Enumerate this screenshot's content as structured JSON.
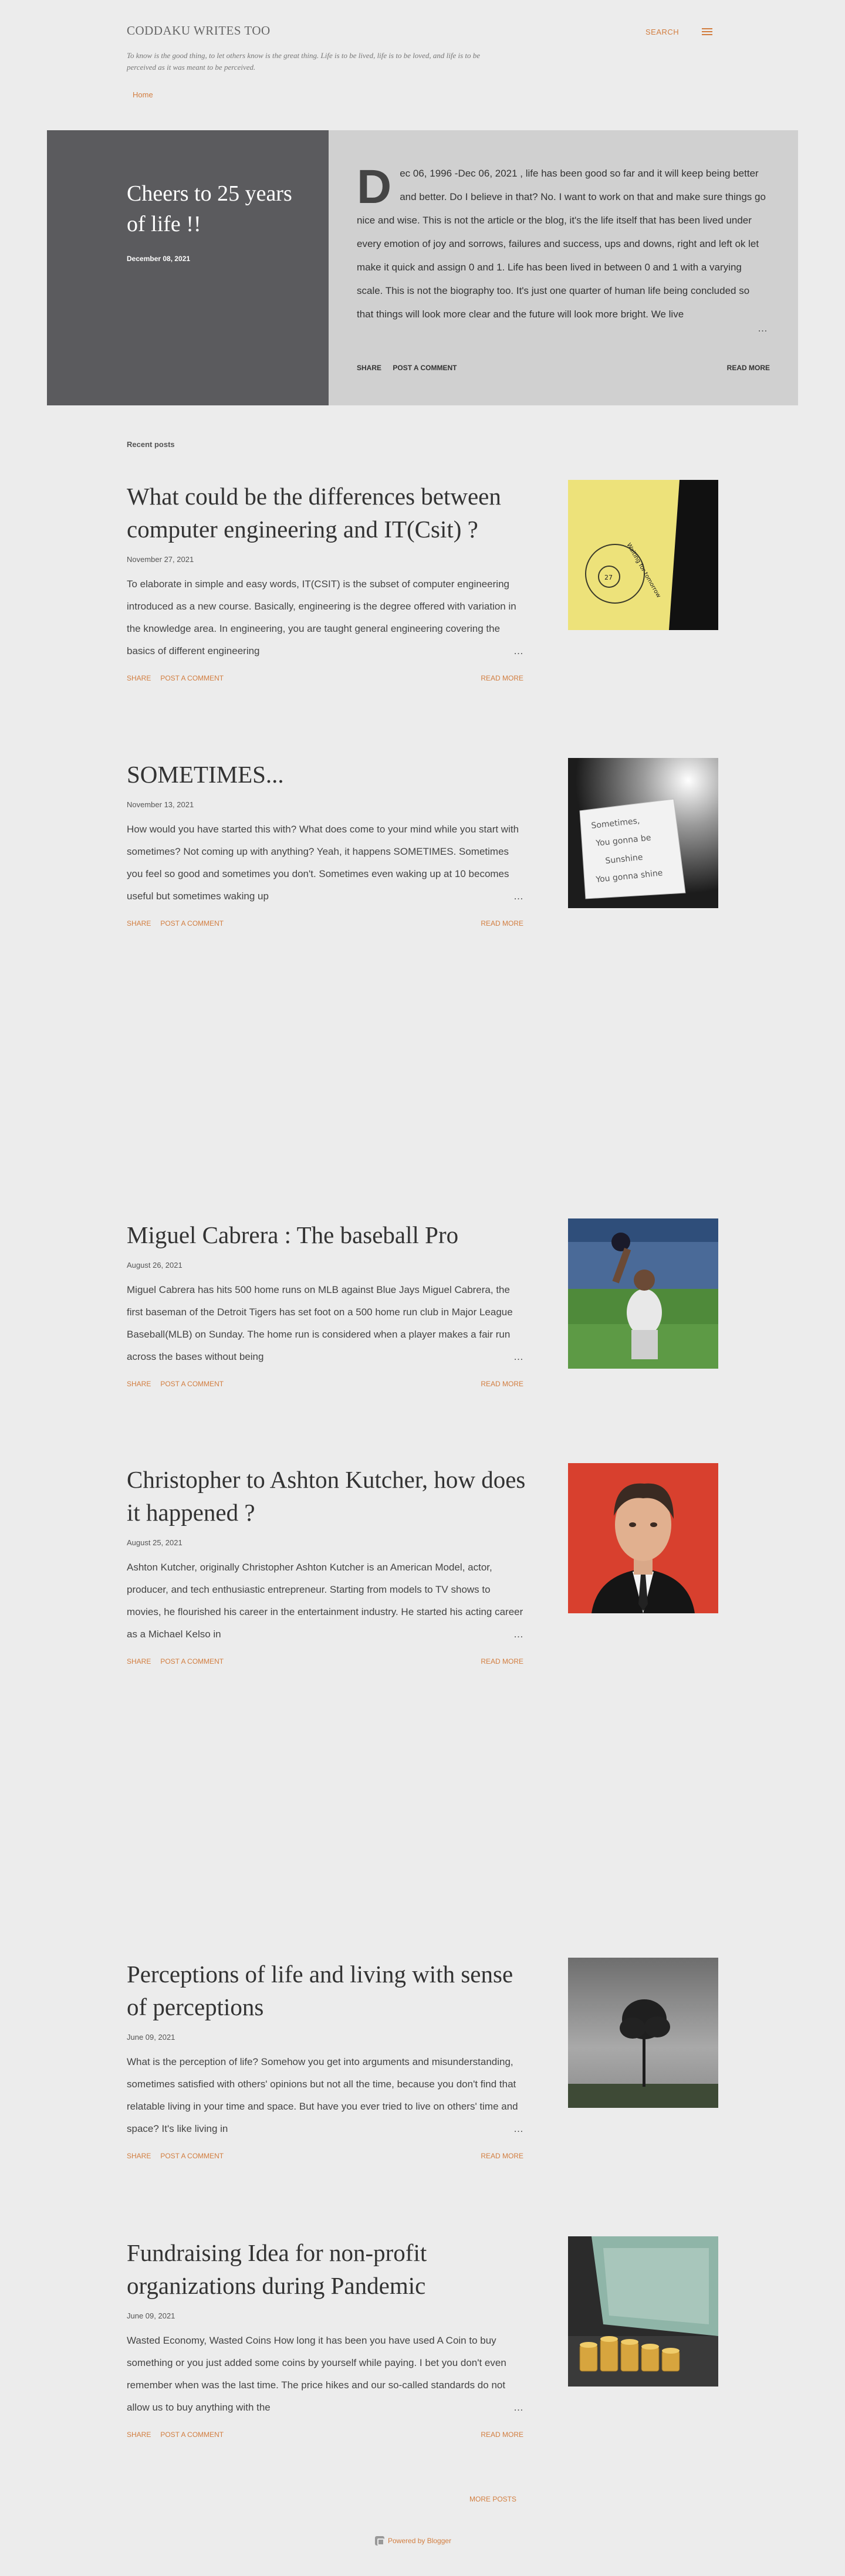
{
  "header": {
    "title": "CODDAKU WRITES TOO",
    "description": "To know is the good thing, to let others know is the great thing. Life is to be lived, life is to be loved, and life is to be perceived as it was meant to be perceived.",
    "search_label": "SEARCH"
  },
  "nav": {
    "home": "Home"
  },
  "featured": {
    "title": "Cheers to 25 years of life !!",
    "date": "December 08, 2021",
    "dropcap": "D",
    "snippet": "ec 06, 1996 -Dec 06, 2021 , life has been good so far and it will keep being better and better. Do I believe in that? No. I want to work on that and make sure things go nice and wise. This is not the article or the blog, it's the life itself that has been lived under every emotion of joy and sorrows, failures and success, ups and downs, right and left ok let make it quick and assign 0 and 1. Life has been lived in between 0 and 1 with a varying scale. This is not the biography too. It's just one quarter of human life being concluded so that things will look more clear and the future will look more bright. We live",
    "share": "SHARE",
    "comment": "POST A COMMENT",
    "read_more": "READ MORE"
  },
  "recent_label": "Recent posts",
  "posts": [
    {
      "title": "What could be the differences between computer engineering and IT(Csit) ?",
      "date": "November 27, 2021",
      "snippet": "To elaborate in simple and easy words, IT(CSIT) is the subset of computer engineering introduced as a new course. Basically, engineering is the degree offered with variation in the knowledge area. In engineering, you are taught general engineering covering the basics of different engineering",
      "share": "SHARE",
      "comment": "POST A COMMENT",
      "read_more": "READ MORE"
    },
    {
      "title": "SOMETIMES...",
      "date": "November 13, 2021",
      "snippet": "How would you have started this with? What does come to your mind while you start with sometimes? Not coming up with anything? Yeah, it happens SOMETIMES. Sometimes you feel so good and sometimes you don't. Sometimes even waking up at 10 becomes useful but sometimes waking up",
      "share": "SHARE",
      "comment": "POST A COMMENT",
      "read_more": "READ MORE"
    },
    {
      "title": "Miguel Cabrera : The baseball Pro",
      "date": "August 26, 2021",
      "snippet": "Miguel Cabrera has hits 500 home runs on MLB against Blue Jays Miguel Cabrera, the first baseman of the Detroit Tigers has set foot on a 500 home run club in Major League Baseball(MLB) on Sunday. The home run is considered when a player makes a fair run across the bases without being",
      "share": "SHARE",
      "comment": "POST A COMMENT",
      "read_more": "READ MORE"
    },
    {
      "title": "Christopher to Ashton Kutcher, how does it happened ?",
      "date": "August 25, 2021",
      "snippet": "Ashton Kutcher, originally Christopher Ashton Kutcher is an American Model, actor, producer, and tech enthusiastic entrepreneur. Starting from models to TV shows to movies, he flourished his career in the entertainment industry. He started his acting career as a Michael Kelso in",
      "share": "SHARE",
      "comment": "POST A COMMENT",
      "read_more": "READ MORE"
    },
    {
      "title": "Perceptions of life and living with sense of perceptions",
      "date": "June 09, 2021",
      "snippet": "What is the perception of life? Somehow you get into arguments and misunderstanding, sometimes satisfied with others' opinions but not all the time, because you don't find that relatable living in your time and space. But have you ever tried to live on others' time and space? It's like living in",
      "share": "SHARE",
      "comment": "POST A COMMENT",
      "read_more": "READ MORE"
    },
    {
      "title": "Fundraising Idea for non-profit organizations during Pandemic",
      "date": "June 09, 2021",
      "snippet": "Wasted Economy, Wasted Coins How long it has been you have used A Coin to buy something or you just added some coins by yourself while paying. I bet you don't even remember when was the last time. The price hikes and our so-called standards do not allow us to buy anything with the",
      "share": "SHARE",
      "comment": "POST A COMMENT",
      "read_more": "READ MORE"
    }
  ],
  "sticky_note": {
    "number": "27",
    "text": "Waiting for tomorrow"
  },
  "note2": {
    "lines": [
      "Sometimes,",
      "You gonna be",
      "Sunshine",
      "You gonna shine"
    ]
  },
  "more_posts": "MORE POSTS",
  "powered_by": "Powered by Blogger",
  "colors": {
    "accent": "#d27d3f",
    "featured_dark": "#5b5b5e",
    "featured_light": "#d0d0d0",
    "background": "#ececec"
  }
}
